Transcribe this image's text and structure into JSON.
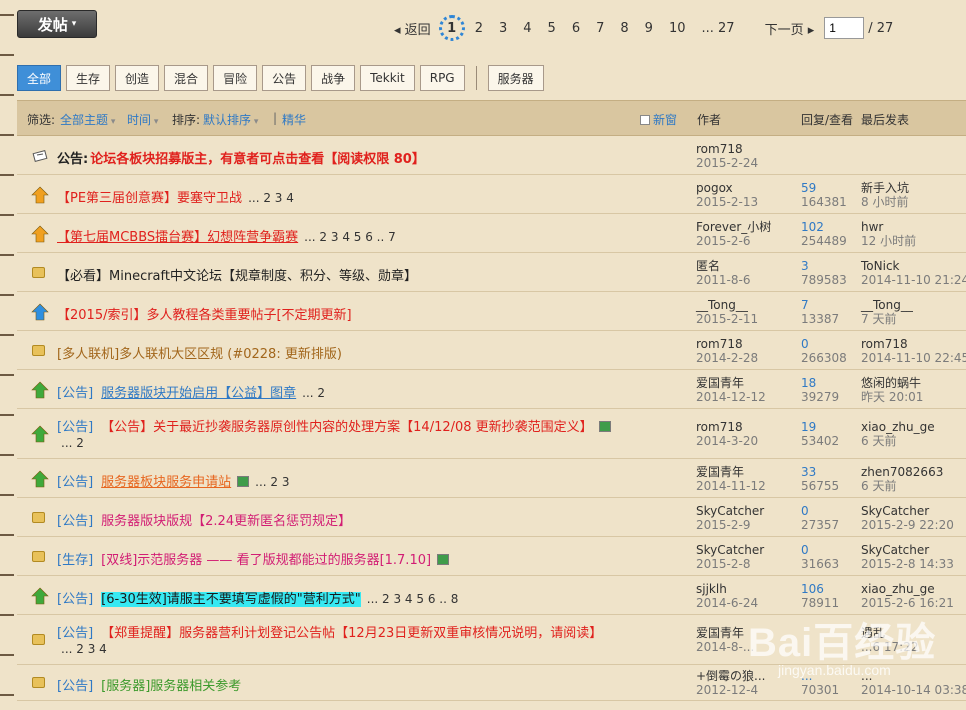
{
  "toolbar": {
    "post_label": "发帖"
  },
  "pager": {
    "back_label": "返回",
    "current": "1",
    "pages": [
      "2",
      "3",
      "4",
      "5",
      "6",
      "7",
      "8",
      "9",
      "10"
    ],
    "last_label": "... 27",
    "next_label": "下一页",
    "input_value": "1",
    "total_label": "/ 27"
  },
  "categories": [
    {
      "label": "全部",
      "active": true
    },
    {
      "label": "生存"
    },
    {
      "label": "创造"
    },
    {
      "label": "混合"
    },
    {
      "label": "冒险"
    },
    {
      "label": "公告"
    },
    {
      "label": "战争"
    },
    {
      "label": "Tekkit"
    },
    {
      "label": "RPG"
    }
  ],
  "server_tab": "服务器",
  "filterbar": {
    "filter_label": "筛选:",
    "all_topics": "全部主题",
    "time": "时间",
    "sort_label": "排序:",
    "default_sort": "默认排序",
    "divider": "|",
    "digest": "精华",
    "new_window": "新窗",
    "col_author": "作者",
    "col_stats": "回复/查看",
    "col_last": "最后发表"
  },
  "threads": [
    {
      "icon": "announcement",
      "prefix": "公告:",
      "title": "论坛各板块招募版主，有意者可点击查看【阅读权限 80】",
      "color": "red",
      "bold": true,
      "author": "rom718",
      "date": "2015-2-24",
      "replies": "",
      "views": "",
      "last_user": "",
      "last_time": ""
    },
    {
      "icon": "up-orange",
      "prefix": "",
      "title": "【PE第三届创意赛】要塞守卫战",
      "pages": "... 2 3 4",
      "color": "red",
      "author": "pogox",
      "date": "2015-2-13",
      "replies": "59",
      "views": "164381",
      "last_user": "新手入坑",
      "last_time": "8 小时前"
    },
    {
      "icon": "up-orange",
      "prefix": "",
      "title": "【第七届MCBBS擂台赛】幻想阵营争霸赛",
      "pages": "... 2 3 4 5 6 .. 7",
      "color": "red",
      "underline": true,
      "author": "Forever_小树",
      "date": "2015-2-6",
      "replies": "102",
      "views": "254489",
      "last_user": "hwr",
      "last_time": "12 小时前"
    },
    {
      "icon": "lock",
      "prefix": "",
      "title": "【必看】Minecraft中文论坛【规章制度、积分、等级、勋章】",
      "color": "dark",
      "author": "匿名",
      "date": "2011-8-6",
      "replies": "3",
      "views": "789583",
      "last_user": "ToNick",
      "last_time": "2014-11-10 21:24"
    },
    {
      "icon": "up-blue",
      "prefix": "",
      "title": "【2015/索引】多人教程各类重要帖子[不定期更新]",
      "color": "red",
      "author": "__Tong__",
      "date": "2015-2-11",
      "replies": "7",
      "views": "13387",
      "last_user": "__Tong__",
      "last_time": "7 天前"
    },
    {
      "icon": "lock",
      "prefix": "",
      "title": "[多人联机]多人联机大区区规 (#0228: 更新排版)",
      "color": "brown",
      "author": "rom718",
      "date": "2014-2-28",
      "replies": "0",
      "views": "266308",
      "last_user": "rom718",
      "last_time": "2014-11-10 22:45"
    },
    {
      "icon": "up-green",
      "prefix": "[公告]",
      "title": "服务器版块开始启用【公益】图章",
      "pages": "... 2",
      "color": "blue",
      "underline": true,
      "author": "爱国青年",
      "date": "2014-12-12",
      "replies": "18",
      "views": "39279",
      "last_user": "悠闲的蜗牛",
      "last_time": "昨天 20:01"
    },
    {
      "icon": "up-green",
      "prefix": "[公告]",
      "title": "【公告】关于最近抄袭服务器原创性内容的处理方案【14/12/08 更新抄袭范围定义】",
      "pages2": "... 2",
      "img": true,
      "color": "red",
      "author": "rom718",
      "date": "2014-3-20",
      "replies": "19",
      "views": "53402",
      "last_user": "xiao_zhu_ge",
      "last_time": "6 天前"
    },
    {
      "icon": "up-green",
      "prefix": "[公告]",
      "title": "服务器板块服务申请站",
      "pages": "... 2 3",
      "img": true,
      "color": "orange",
      "underline": true,
      "author": "爱国青年",
      "date": "2014-11-12",
      "replies": "33",
      "views": "56755",
      "last_user": "zhen7082663",
      "last_time": "6 天前"
    },
    {
      "icon": "lock",
      "prefix": "[公告]",
      "title": "服务器版块版规【2.24更新匿名惩罚规定】",
      "color": "pink",
      "author": "SkyCatcher",
      "date": "2015-2-9",
      "replies": "0",
      "views": "27357",
      "last_user": "SkyCatcher",
      "last_time": "2015-2-9 22:20"
    },
    {
      "icon": "lock",
      "prefix": "[生存]",
      "title": "[双线]示范服务器 —— 看了版规都能过的服务器[1.7.10]",
      "img": true,
      "color": "pink",
      "author": "SkyCatcher",
      "date": "2015-2-8",
      "replies": "0",
      "views": "31663",
      "last_user": "SkyCatcher",
      "last_time": "2015-2-8 14:33"
    },
    {
      "icon": "up-green",
      "prefix": "[公告]",
      "title": "[6-30生效]请服主不要填写虚假的\"营利方式\"",
      "pages": "... 2 3 4 5 6 .. 8",
      "color": "dark",
      "highlight": true,
      "author": "sjjklh",
      "date": "2014-6-24",
      "replies": "106",
      "views": "78911",
      "last_user": "xiao_zhu_ge",
      "last_time": "2015-2-6 16:21"
    },
    {
      "icon": "lock",
      "prefix": "[公告]",
      "title": "【郑重提醒】服务器营利计划登记公告帖【12月23日更新双重审核情况说明，请阅读】",
      "pages2": "... 2 3 4",
      "color": "red",
      "author": "爱国青年",
      "date": "2014-8-...",
      "replies": "",
      "views": "",
      "last_user": "遇乱",
      "last_time": "...6 17:22"
    },
    {
      "icon": "lock",
      "prefix": "[公告]",
      "title": "[服务器]服务器相关参考",
      "color": "green",
      "author": "+倒霉の狼...",
      "date": "2012-12-4",
      "replies": "...",
      "views": "70301",
      "last_user": "...",
      "last_time": "2014-10-14 03:38"
    }
  ],
  "watermark": {
    "text": "Bai百经验",
    "sub": "jingyan.baidu.com"
  }
}
